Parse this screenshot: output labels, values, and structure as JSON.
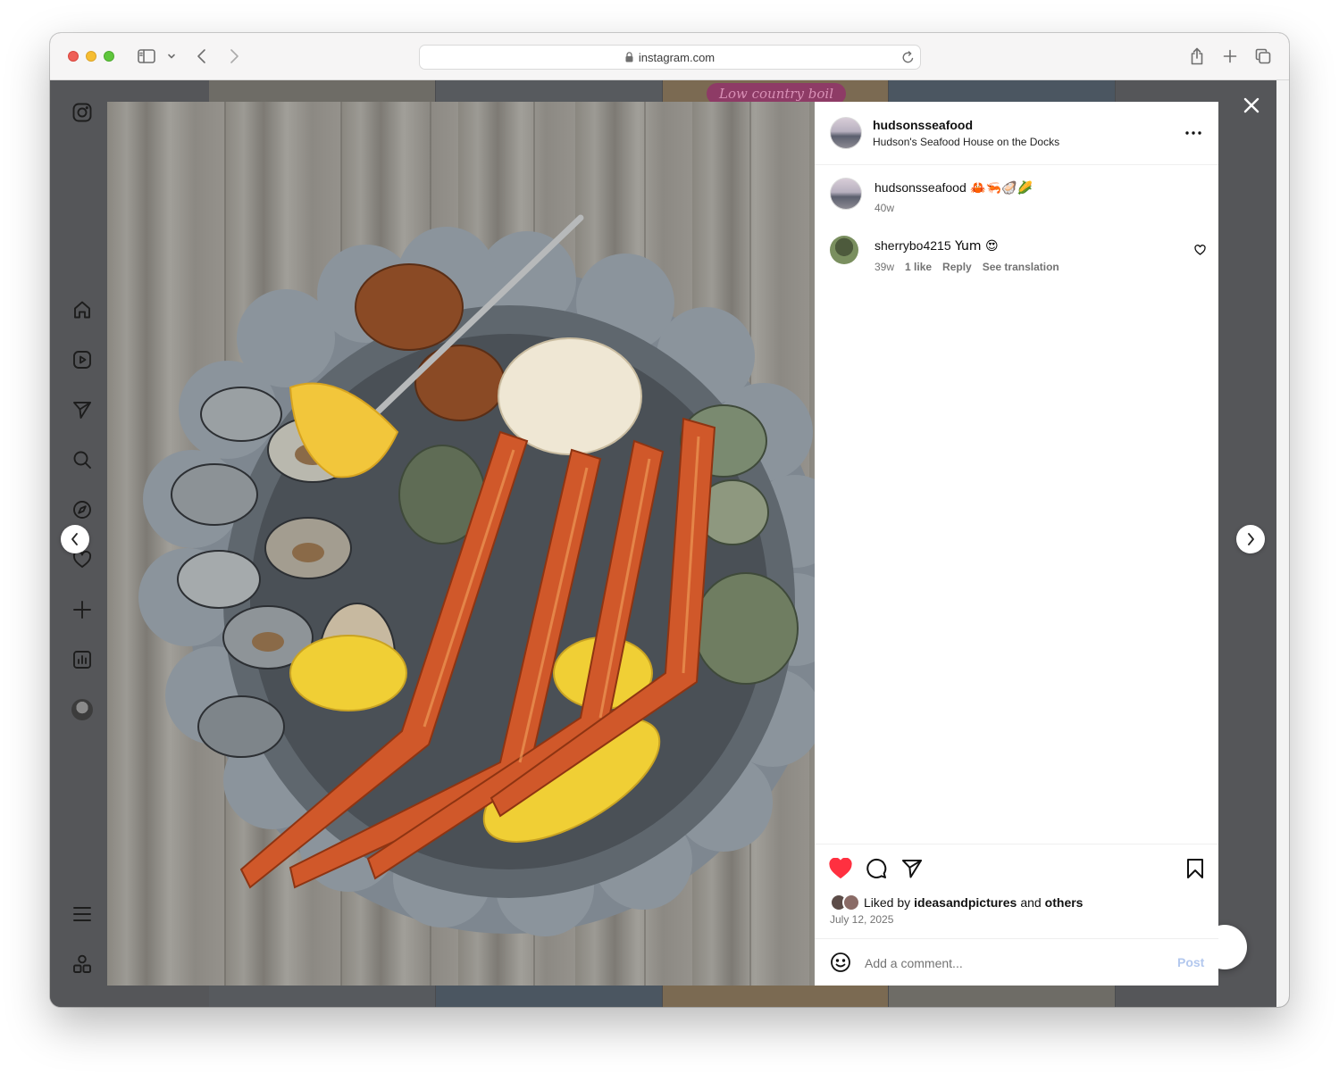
{
  "browser": {
    "url": "instagram.com"
  },
  "background": {
    "tile_label": "Low country boil"
  },
  "sidebar": {
    "items": [
      {
        "name": "instagram-logo-icon"
      },
      {
        "name": "home-icon"
      },
      {
        "name": "reels-icon"
      },
      {
        "name": "messages-icon"
      },
      {
        "name": "search-icon"
      },
      {
        "name": "explore-icon"
      },
      {
        "name": "notifications-icon"
      },
      {
        "name": "create-icon"
      },
      {
        "name": "dashboard-icon"
      },
      {
        "name": "profile-avatar"
      },
      {
        "name": "menu-icon"
      },
      {
        "name": "also-from-meta-icon"
      }
    ]
  },
  "post": {
    "image_alt": "Seafood boil with crab legs, clams, oysters, shrimp, corn and lemon",
    "author": {
      "username": "hudsonsseafood",
      "location": "Hudson's Seafood House on the Docks"
    },
    "caption": {
      "username": "hudsonsseafood",
      "text": "🦀🦐🦪🌽",
      "age": "40w"
    },
    "comments": [
      {
        "username": "sherrybo4215",
        "text": "Yum 😍",
        "age": "39w",
        "likes": "1 like",
        "reply": "Reply",
        "translate": "See translation"
      }
    ],
    "liked_by": {
      "prefix": "Liked by",
      "user": "ideasandpictures",
      "conjunction": "and",
      "suffix": "others"
    },
    "date": "July 12, 2025",
    "comment_box": {
      "placeholder": "Add a comment...",
      "post_label": "Post"
    }
  },
  "colors": {
    "like_red": "#ff3040",
    "post_disabled": "#b3c8ee",
    "overlay": "#555659"
  }
}
